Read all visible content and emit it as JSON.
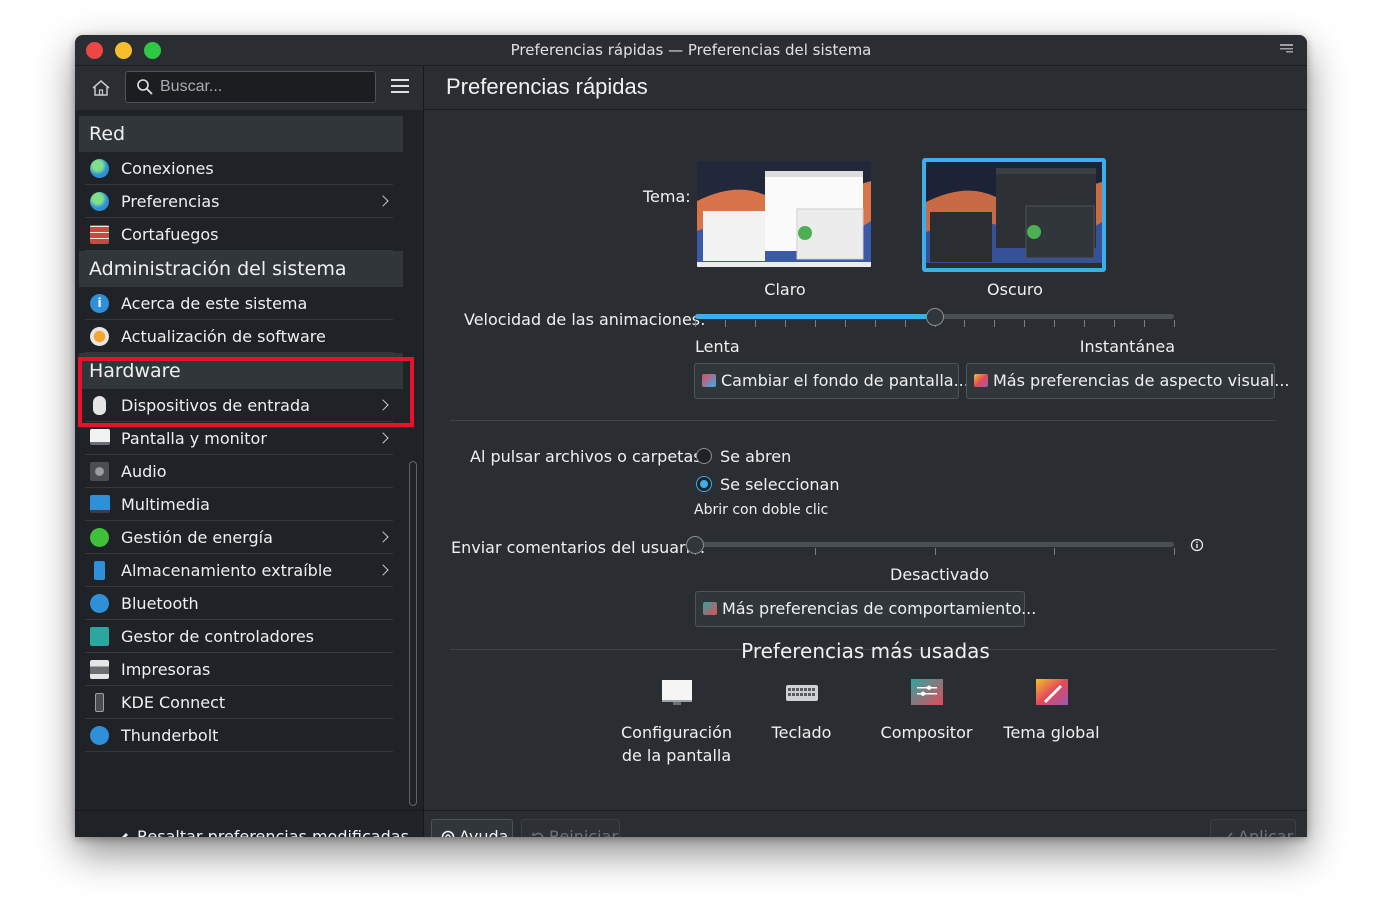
{
  "window": {
    "title": "Preferencias rápidas — Preferencias del sistema"
  },
  "sidebar": {
    "search_placeholder": "Buscar...",
    "sections": [
      {
        "title": "Red",
        "items": [
          {
            "label": "Conexiones",
            "icon": "globe-icon",
            "has_submenu": false
          },
          {
            "label": "Preferencias",
            "icon": "globe-icon",
            "has_submenu": true
          },
          {
            "label": "Cortafuegos",
            "icon": "firewall-icon",
            "has_submenu": false
          }
        ]
      },
      {
        "title": "Administración del sistema",
        "items": [
          {
            "label": "Acerca de este sistema",
            "icon": "info-icon",
            "has_submenu": false
          },
          {
            "label": "Actualización de software",
            "icon": "update-icon",
            "has_submenu": false
          }
        ]
      },
      {
        "title": "Hardware",
        "items": [
          {
            "label": "Dispositivos de entrada",
            "icon": "mouse-icon",
            "has_submenu": true
          },
          {
            "label": "Pantalla y monitor",
            "icon": "monitor-icon",
            "has_submenu": true
          },
          {
            "label": "Audio",
            "icon": "speaker-icon",
            "has_submenu": false
          },
          {
            "label": "Multimedia",
            "icon": "multimedia-icon",
            "has_submenu": false
          },
          {
            "label": "Gestión de energía",
            "icon": "battery-icon",
            "has_submenu": true
          },
          {
            "label": "Almacenamiento extraíble",
            "icon": "usb-icon",
            "has_submenu": true
          },
          {
            "label": "Bluetooth",
            "icon": "bluetooth-icon",
            "has_submenu": false
          },
          {
            "label": "Gestor de controladores",
            "icon": "driver-icon",
            "has_submenu": false
          },
          {
            "label": "Impresoras",
            "icon": "printer-icon",
            "has_submenu": false
          },
          {
            "label": "KDE Connect",
            "icon": "phone-icon",
            "has_submenu": false
          },
          {
            "label": "Thunderbolt",
            "icon": "thunderbolt-icon",
            "has_submenu": false
          }
        ]
      }
    ],
    "highlight_label": "Resaltar preferencias modificadas"
  },
  "main": {
    "title": "Preferencias rápidas",
    "theme_label": "Tema:",
    "theme_light": "Claro",
    "theme_dark": "Oscuro",
    "theme_selected": "Oscuro",
    "animation_label": "Velocidad de las animaciones:",
    "animation_min": "Lenta",
    "animation_max": "Instantánea",
    "animation_value": 0.5,
    "wallpaper_button": "Cambiar el fondo de pantalla...",
    "appearance_button": "Más preferencias de aspecto visual...",
    "click_label": "Al pulsar archivos o carpetas:",
    "click_open": "Se abren",
    "click_select": "Se seleccionan",
    "click_selected": "Se seleccionan",
    "click_hint": "Abrir con doble clic",
    "feedback_label": "Enviar comentarios del usuario:",
    "feedback_value": "Desactivado",
    "feedback_level": 0,
    "behavior_button": "Más preferencias de comportamiento...",
    "favorites_title": "Preferencias más usadas",
    "favorites": [
      {
        "label": "Configuración de la pantalla",
        "icon": "display-config-icon"
      },
      {
        "label": "Teclado",
        "icon": "keyboard-icon"
      },
      {
        "label": "Compositor",
        "icon": "compositor-icon"
      },
      {
        "label": "Tema global",
        "icon": "global-theme-icon"
      }
    ]
  },
  "footer": {
    "help": "Ayuda",
    "reset": "Reiniciar",
    "apply": "Aplicar"
  },
  "colors": {
    "accent": "#3daee9",
    "highlight_box": "#e8132a",
    "window_bg": "#2a2e32"
  }
}
